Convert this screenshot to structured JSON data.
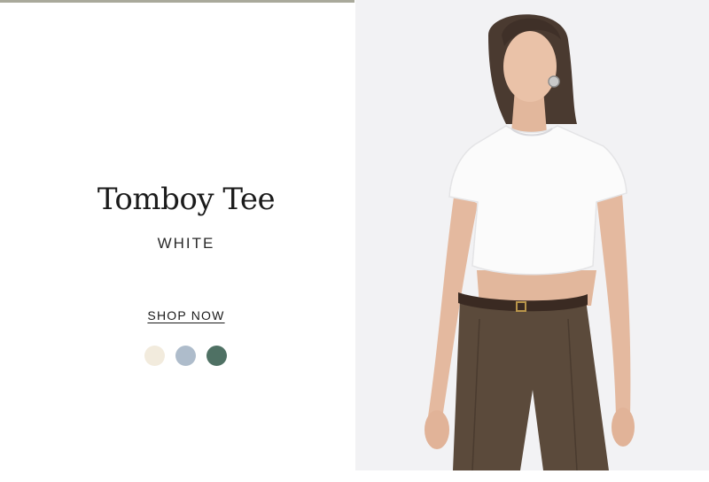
{
  "promo": {
    "product_name": "Tomboy Tee",
    "color_name": "WHITE",
    "cta_label": "SHOP NOW"
  },
  "swatches": [
    {
      "name": "cream",
      "color": "#f2ebdd"
    },
    {
      "name": "light-blue",
      "color": "#aebccb"
    },
    {
      "name": "dark-green",
      "color": "#4f7164"
    }
  ],
  "colors": {
    "top_rule": "#a9a99b",
    "photo_background": "#f2f2f4"
  }
}
